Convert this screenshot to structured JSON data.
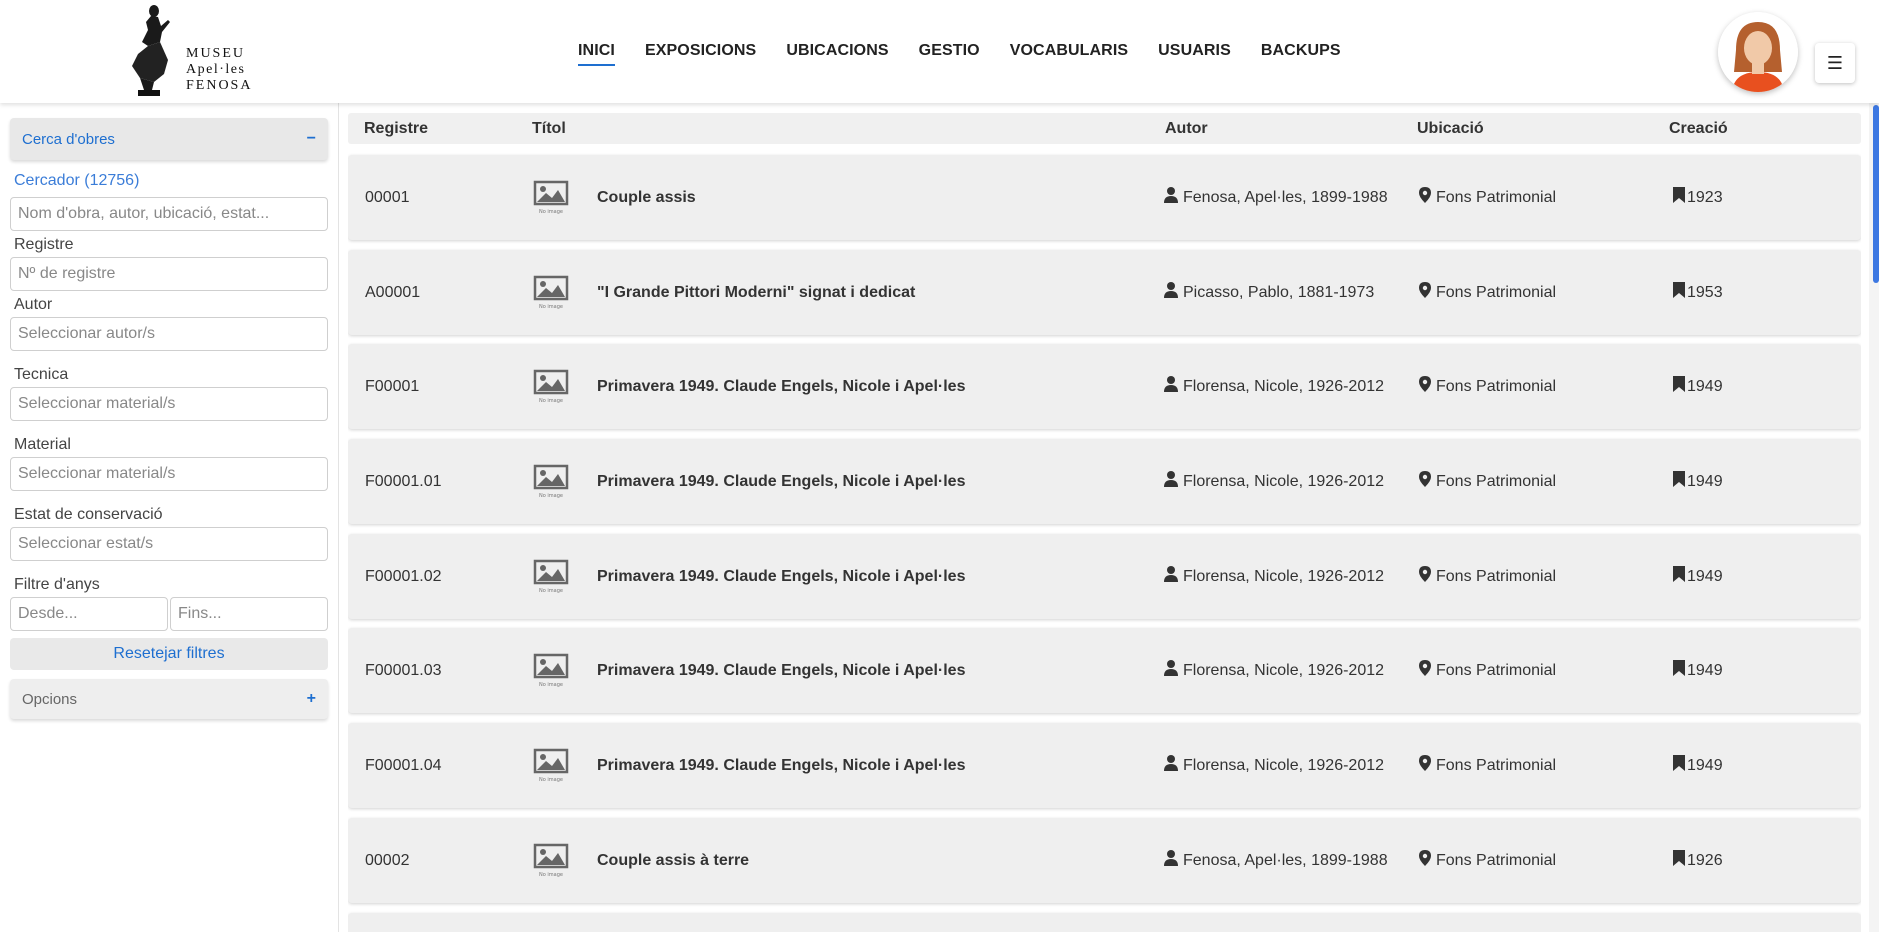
{
  "brand": {
    "line1": "MUSEU",
    "line2": "Apel·les",
    "line3": "FENOSA"
  },
  "nav": {
    "items": [
      {
        "label": "INICI",
        "active": true
      },
      {
        "label": "EXPOSICIONS"
      },
      {
        "label": "UBICACIONS"
      },
      {
        "label": "GESTIO"
      },
      {
        "label": "VOCABULARIS"
      },
      {
        "label": "USUARIS"
      },
      {
        "label": "BACKUPS"
      }
    ],
    "menu_icon": "☰"
  },
  "sidebar": {
    "search_panel_title": "Cerca d'obres",
    "search_panel_toggle": "−",
    "search_label": "Cercador (12756)",
    "search_placeholder": "Nom d'obra, autor, ubicació, estat...",
    "registre_label": "Registre",
    "registre_placeholder": "Nº de registre",
    "autor_label": "Autor",
    "autor_placeholder": "Seleccionar autor/s",
    "tecnica_label": "Tecnica",
    "tecnica_placeholder": "Seleccionar material/s",
    "material_label": "Material",
    "material_placeholder": "Seleccionar material/s",
    "estat_label": "Estat de conservació",
    "estat_placeholder": "Seleccionar estat/s",
    "anys_label": "Filtre d'anys",
    "desde_placeholder": "Desde...",
    "fins_placeholder": "Fins...",
    "reset_label": "Resetejar filtres",
    "options_title": "Opcions",
    "options_toggle": "+"
  },
  "table": {
    "headers": {
      "registre": "Registre",
      "titol": "Títol",
      "autor": "Autor",
      "ubicacio": "Ubicació",
      "creacio": "Creació"
    },
    "rows": [
      {
        "registre": "00001",
        "titol": "Couple assis",
        "autor": "Fenosa, Apel·les, 1899-1988",
        "ubicacio": "Fons Patrimonial",
        "creacio": "1923"
      },
      {
        "registre": "A00001",
        "titol": "\"I Grande Pittori Moderni\" signat i dedicat",
        "autor": "Picasso, Pablo, 1881-1973",
        "ubicacio": "Fons Patrimonial",
        "creacio": "1953"
      },
      {
        "registre": "F00001",
        "titol": "Primavera 1949. Claude Engels, Nicole i Apel·les",
        "autor": "Florensa, Nicole, 1926-2012",
        "ubicacio": "Fons Patrimonial",
        "creacio": "1949"
      },
      {
        "registre": "F00001.01",
        "titol": "Primavera 1949. Claude Engels, Nicole i Apel·les",
        "autor": "Florensa, Nicole, 1926-2012",
        "ubicacio": "Fons Patrimonial",
        "creacio": "1949"
      },
      {
        "registre": "F00001.02",
        "titol": "Primavera 1949. Claude Engels, Nicole i Apel·les",
        "autor": "Florensa, Nicole, 1926-2012",
        "ubicacio": "Fons Patrimonial",
        "creacio": "1949"
      },
      {
        "registre": "F00001.03",
        "titol": "Primavera 1949. Claude Engels, Nicole i Apel·les",
        "autor": "Florensa, Nicole, 1926-2012",
        "ubicacio": "Fons Patrimonial",
        "creacio": "1949"
      },
      {
        "registre": "F00001.04",
        "titol": "Primavera 1949. Claude Engels, Nicole i Apel·les",
        "autor": "Florensa, Nicole, 1926-2012",
        "ubicacio": "Fons Patrimonial",
        "creacio": "1949"
      },
      {
        "registre": "00002",
        "titol": "Couple assis à terre",
        "autor": "Fenosa, Apel·les, 1899-1988",
        "ubicacio": "Fons Patrimonial",
        "creacio": "1926"
      }
    ],
    "thumb_caption": "No image"
  },
  "colors": {
    "accent": "#1e6fd0",
    "scrollbar": "#3d78e2",
    "row_bg": "#efefef"
  }
}
